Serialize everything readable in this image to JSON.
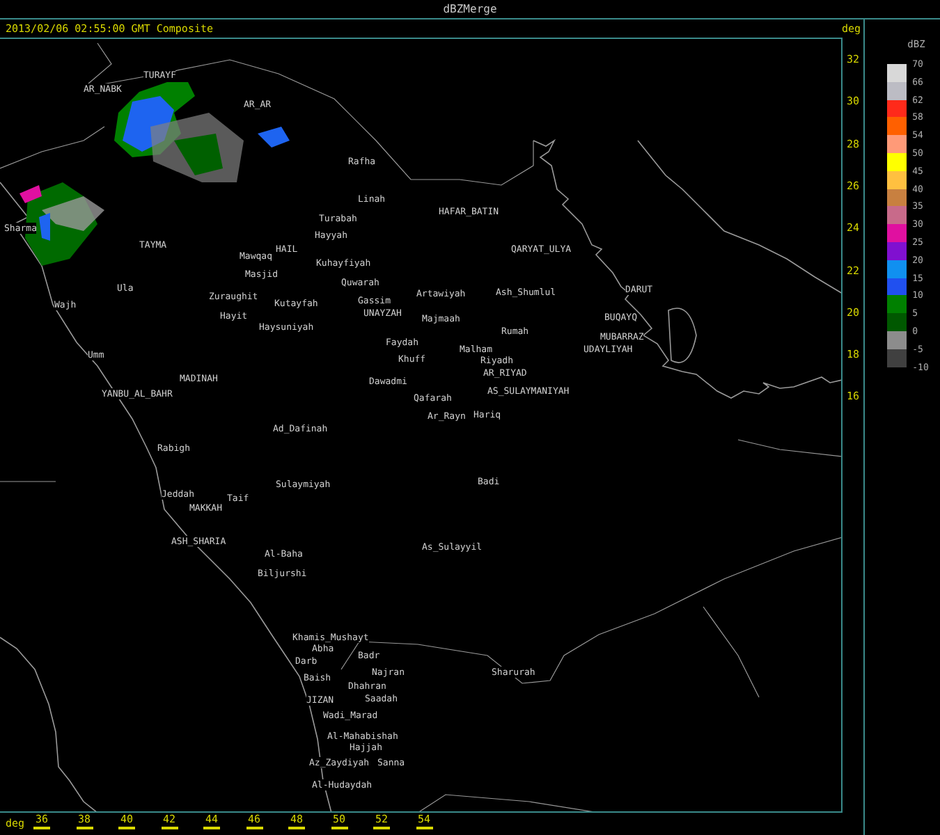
{
  "window": {
    "title": "dBZMerge"
  },
  "info": {
    "timestamp": "2013/02/06 02:55:00 GMT Composite"
  },
  "y_axis": {
    "label": "deg",
    "ticks": [
      "32",
      "30",
      "28",
      "26",
      "24",
      "22",
      "20",
      "18",
      "16"
    ]
  },
  "x_axis": {
    "label": "deg",
    "ticks": [
      "36",
      "38",
      "40",
      "42",
      "44",
      "46",
      "48",
      "50",
      "52",
      "54"
    ]
  },
  "map": {
    "places": [
      {
        "name": "TURAYF"
      },
      {
        "name": "AR_NABK"
      },
      {
        "name": "AR_AR"
      },
      {
        "name": "Rafha"
      },
      {
        "name": "Linah"
      },
      {
        "name": "Turabah"
      },
      {
        "name": "Hayyah"
      },
      {
        "name": "Kuhayfiyah"
      },
      {
        "name": "Quwarah"
      },
      {
        "name": "Mawqaq"
      },
      {
        "name": "HAIL"
      },
      {
        "name": "Masjid"
      },
      {
        "name": "TAYMA"
      },
      {
        "name": "Ula"
      },
      {
        "name": "Wajh"
      },
      {
        "name": "Umm"
      },
      {
        "name": "Zuraughit"
      },
      {
        "name": "Hayit"
      },
      {
        "name": "Kutayfah"
      },
      {
        "name": "Haysuniyah"
      },
      {
        "name": "Gassim"
      },
      {
        "name": "UNAYZAH"
      },
      {
        "name": "Artawiyah"
      },
      {
        "name": "Majmaah"
      },
      {
        "name": "Faydah"
      },
      {
        "name": "Khuff"
      },
      {
        "name": "Dawadmi"
      },
      {
        "name": "Qafarah"
      },
      {
        "name": "Ar_Rayn"
      },
      {
        "name": "MADINAH"
      },
      {
        "name": "YANBU_AL_BAHR"
      },
      {
        "name": "Ad_Dafinah"
      },
      {
        "name": "Rabigh"
      },
      {
        "name": "Sharma"
      },
      {
        "name": "HAFAR_BATIN"
      },
      {
        "name": "QARYAT_ULYA"
      },
      {
        "name": "Ash_Shumlul"
      },
      {
        "name": "Rumah"
      },
      {
        "name": "Malham"
      },
      {
        "name": "Riyadh"
      },
      {
        "name": "AR_RIYAD"
      },
      {
        "name": "AS_SULAYMANIYAH"
      },
      {
        "name": "Hariq"
      },
      {
        "name": "DARUT"
      },
      {
        "name": "BUQAYQ"
      },
      {
        "name": "MUBARRAZ"
      },
      {
        "name": "UDAYLIYAH"
      },
      {
        "name": "Sulaymiyah"
      },
      {
        "name": "Badi"
      },
      {
        "name": "As_Sulayyil"
      },
      {
        "name": "Al-Baha"
      },
      {
        "name": "Biljurshi"
      },
      {
        "name": "Jeddah"
      },
      {
        "name": "MAKKAH"
      },
      {
        "name": "Taif"
      },
      {
        "name": "ASH_SHARIA"
      },
      {
        "name": "Khamis_Mushayt"
      },
      {
        "name": "Abha"
      },
      {
        "name": "Badr"
      },
      {
        "name": "Darb"
      },
      {
        "name": "Najran"
      },
      {
        "name": "Sharurah"
      },
      {
        "name": "Baish"
      },
      {
        "name": "Dhahran"
      },
      {
        "name": "Saadah"
      },
      {
        "name": "JIZAN"
      },
      {
        "name": "Wadi_Marad"
      },
      {
        "name": "Al-Mahabishah"
      },
      {
        "name": "Hajjah"
      },
      {
        "name": "Az_Zaydiyah"
      },
      {
        "name": "Sanna"
      },
      {
        "name": "Al-Hudaydah"
      }
    ]
  },
  "legend": {
    "title": "dBZ",
    "labels": [
      "70",
      "66",
      "62",
      "58",
      "54",
      "50",
      "45",
      "40",
      "35",
      "30",
      "25",
      "20",
      "15",
      "10",
      "5",
      "0",
      "-5",
      "-10"
    ],
    "bands": [
      {
        "color": "#d8d8d8"
      },
      {
        "color": "#bcbcc4"
      },
      {
        "color": "#ff2a1a"
      },
      {
        "color": "#ff6000"
      },
      {
        "color": "#ff9a78"
      },
      {
        "color": "#ffff00"
      },
      {
        "color": "#ffc040"
      },
      {
        "color": "#c88040"
      },
      {
        "color": "#c86a8a"
      },
      {
        "color": "#e010a0"
      },
      {
        "color": "#8010d0"
      },
      {
        "color": "#1090f0"
      },
      {
        "color": "#2050f0"
      },
      {
        "color": "#008000"
      },
      {
        "color": "#005800"
      },
      {
        "color": "#8c8c8c"
      },
      {
        "color": "#404040"
      }
    ]
  }
}
